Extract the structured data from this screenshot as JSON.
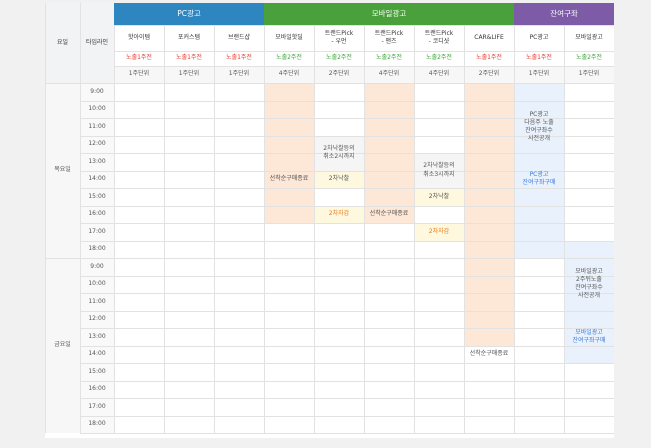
{
  "left_headers": {
    "day": "요일",
    "timeline": "타임라인"
  },
  "groups": [
    {
      "label": "PC광고",
      "color": "#2e86c1"
    },
    {
      "label": "모바일광고",
      "color": "#4aa13b"
    },
    {
      "label": "잔여구좌",
      "color": "#7d5ba6"
    }
  ],
  "columns": [
    {
      "name": "핫아이템",
      "exposure": "노출1주전",
      "exposure_color": "red",
      "unit": "1주단위"
    },
    {
      "name": "포커스템",
      "exposure": "노출1주전",
      "exposure_color": "red",
      "unit": "1주단위"
    },
    {
      "name": "브랜드샵",
      "exposure": "노출1주전",
      "exposure_color": "red",
      "unit": "1주단위"
    },
    {
      "name": "모바일핫딜",
      "exposure": "노출2주전",
      "exposure_color": "green",
      "unit": "4주단위"
    },
    {
      "name": "트랜드Pick\n- 우먼",
      "exposure": "노출2주전",
      "exposure_color": "green",
      "unit": "2주단위"
    },
    {
      "name": "트랜드Pick\n- 맨즈",
      "exposure": "노출2주전",
      "exposure_color": "green",
      "unit": "4주단위"
    },
    {
      "name": "트랜드Pick\n- 코디샷",
      "exposure": "노출2주전",
      "exposure_color": "green",
      "unit": "4주단위"
    },
    {
      "name": "CAR&LIFE",
      "exposure": "노출1주전",
      "exposure_color": "red",
      "unit": "2주단위"
    },
    {
      "name": "PC광고",
      "exposure": "노출1주전",
      "exposure_color": "red",
      "unit": "1주단위"
    },
    {
      "name": "모바일광고",
      "exposure": "노출2주전",
      "exposure_color": "green",
      "unit": "1주단위"
    }
  ],
  "days": [
    "목요일",
    "금요일"
  ],
  "times": [
    "9:00",
    "10:00",
    "11:00",
    "12:00",
    "13:00",
    "14:00",
    "15:00",
    "16:00",
    "17:00",
    "18:00"
  ],
  "colors": {
    "peach": "#fde7d6",
    "light_blue": "#e9f1fc",
    "light_yellow": "#fdf8de",
    "gray_fill": "#f5f5f5"
  },
  "annotations": {
    "mobile_hotdeal_close": "선착순구매종료",
    "womens_cancel": "2차낙찰등의\n취소2시까지",
    "womens_second": "2차낙찰",
    "womens_deadline": "2차자감",
    "mens_close": "선착순구매종료",
    "codishot_cancel": "2차낙찰등의\n취소3시까지",
    "codishot_second": "2차낙찰",
    "codishot_deadline": "2차자감",
    "carlife_close": "선착순구매종료",
    "pc_remain_info": "PC광고\n다음주 노출\n잔여구좌수\n사전공개",
    "pc_remain_buy": "PC광고\n잔여구좌구매",
    "mobile_remain_info": "모바일광고\n2주뒤노출\n잔여구좌수\n사전공개",
    "mobile_remain_buy": "모바일광고\n잔여구좌구매"
  }
}
